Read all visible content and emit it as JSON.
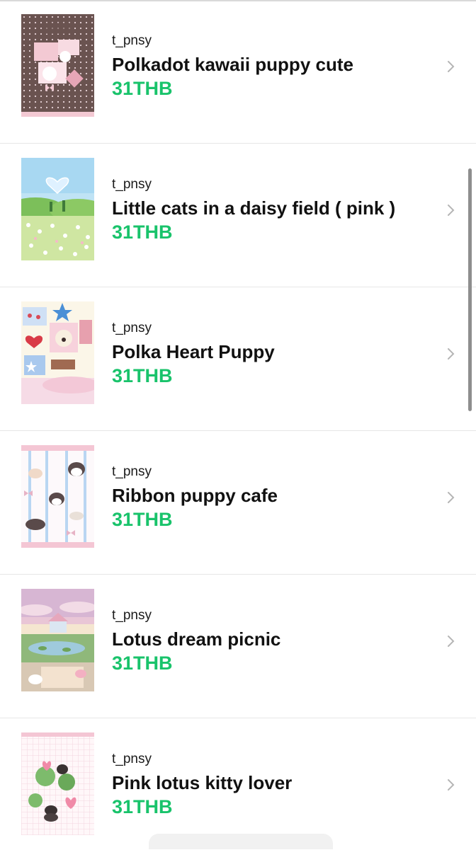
{
  "items": [
    {
      "creator": "t_pnsy",
      "title": "Polkadot kawaii puppy cute",
      "price": "31THB",
      "thumb_icon": "polkadot-puppy-thumbnail"
    },
    {
      "creator": "t_pnsy",
      "title": "Little cats in a daisy field ( pink )",
      "price": "31THB",
      "thumb_icon": "daisy-field-thumbnail"
    },
    {
      "creator": "t_pnsy",
      "title": "Polka Heart Puppy",
      "price": "31THB",
      "thumb_icon": "heart-puppy-thumbnail"
    },
    {
      "creator": "t_pnsy",
      "title": "Ribbon puppy cafe",
      "price": "31THB",
      "thumb_icon": "ribbon-cafe-thumbnail"
    },
    {
      "creator": "t_pnsy",
      "title": "Lotus dream picnic",
      "price": "31THB",
      "thumb_icon": "lotus-picnic-thumbnail"
    },
    {
      "creator": "t_pnsy",
      "title": "Pink lotus kitty lover",
      "price": "31THB",
      "thumb_icon": "pink-lotus-thumbnail"
    }
  ],
  "colors": {
    "price": "#19c36b",
    "divider": "#e6e6e6",
    "chevron": "#b5b5b5"
  }
}
